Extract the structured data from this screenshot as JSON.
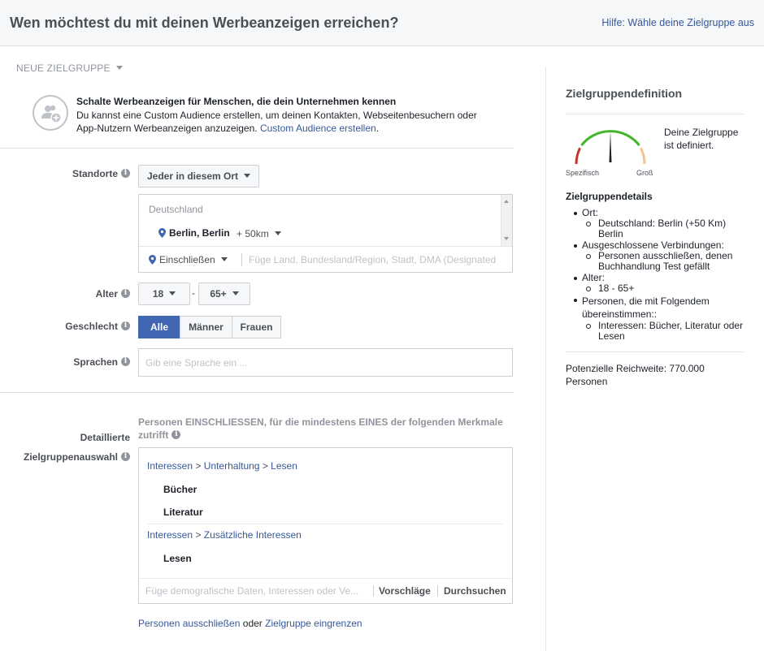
{
  "header": {
    "title": "Wen möchtest du mit deinen Werbeanzeigen erreichen?",
    "help_link": "Hilfe: Wähle deine Zielgruppe aus"
  },
  "audience_dropdown": "NEUE ZIELGRUPPE",
  "custom_audience": {
    "title": "Schalte Werbeanzeigen für Menschen, die dein Unternehmen kennen",
    "text": "Du kannst eine Custom Audience erstellen, um deinen Kontakten, Webseitenbesuchern oder App-Nutzern Werbeanzeigen anzuzeigen.",
    "link": "Custom Audience erstellen",
    "link_suffix": "."
  },
  "locations": {
    "label": "Standorte",
    "type_dropdown": "Jeder in diesem Ort",
    "country": "Deutschland",
    "city": "Berlin, Berlin",
    "radius": "+ 50km",
    "include_dropdown": "Einschließen",
    "input_placeholder": "Füge Land, Bundesland/Region, Stadt, DMA (Designated"
  },
  "age": {
    "label": "Alter",
    "min": "18",
    "separator": "-",
    "max": "65+"
  },
  "gender": {
    "label": "Geschlecht",
    "options": [
      "Alle",
      "Männer",
      "Frauen"
    ],
    "selected": "Alle"
  },
  "languages": {
    "label": "Sprachen",
    "placeholder": "Gib eine Sprache ein ..."
  },
  "detailed_targeting": {
    "label_line1": "Detaillierte",
    "label_line2": "Zielgruppenauswahl",
    "description": "Personen EINSCHLIESSEN, für die mindestens EINES der folgenden Merkmale zutrifft",
    "groups": [
      {
        "crumb": [
          "Interessen",
          "Unterhaltung",
          "Lesen"
        ],
        "items": [
          "Bücher",
          "Literatur"
        ]
      },
      {
        "crumb": [
          "Interessen",
          "Zusätzliche Interessen"
        ],
        "items": [
          "Lesen"
        ]
      }
    ],
    "crumb_separator": ">",
    "input_placeholder": "Füge demografische Daten, Interessen oder Ve...",
    "suggestions": "Vorschläge",
    "browse": "Durchsuchen"
  },
  "bottom_links": {
    "exclude": "Personen ausschließen",
    "or": "oder",
    "narrow": "Zielgruppe eingrenzen"
  },
  "audience_definition": {
    "title": "Zielgruppendefinition",
    "gauge_min": "Spezifisch",
    "gauge_max": "Groß",
    "gauge_level": 0.5,
    "colors": {
      "red": "#c0392b",
      "green": "#42b72a",
      "orange": "#f5c28e",
      "needle": "#1d2129"
    },
    "status": "Deine Zielgruppe ist definiert.",
    "details_title": "Zielgruppendetails",
    "details": {
      "location_label": "Ort:",
      "location_value": "Deutschland: Berlin (+50 Km) Berlin",
      "excluded_label": "Ausgeschlossene Verbindungen:",
      "excluded_value": "Personen ausschließen, denen Buchhandlung Test gefällt",
      "age_label": "Alter:",
      "age_value": "18 - 65+",
      "match_label": "Personen, die mit Folgendem übereinstimmen::",
      "match_value": "Interessen: Bücher, Literatur oder Lesen"
    },
    "reach": "Potenzielle Reichweite: 770.000 Personen"
  },
  "icons": [
    "info-icon",
    "location-pin-icon",
    "add-audience-icon",
    "caret-down-icon",
    "scroll-up-icon",
    "scroll-down-icon"
  ]
}
